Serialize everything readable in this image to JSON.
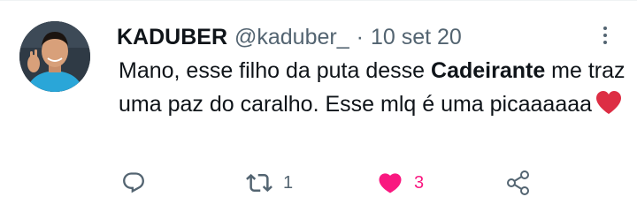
{
  "tweet": {
    "author_name": "KADUBER",
    "handle": "@kaduber_",
    "separator": "·",
    "date": "10 set 20",
    "text_before": "Mano, esse filho da puta desse ",
    "text_bold": "Cadeirante",
    "text_after": " me traz uma paz do caralho. Esse mlq é uma picaaaaaa",
    "emoji": "red-heart-emoji"
  },
  "actions": {
    "reply_count": "",
    "retweet_count": "1",
    "like_count": "3",
    "liked": true,
    "like_color": "#f91880",
    "icon_color": "#536471"
  },
  "icons": {
    "reply": "reply-icon",
    "retweet": "retweet-icon",
    "like": "heart-icon",
    "share": "share-icon",
    "more": "more-icon"
  }
}
